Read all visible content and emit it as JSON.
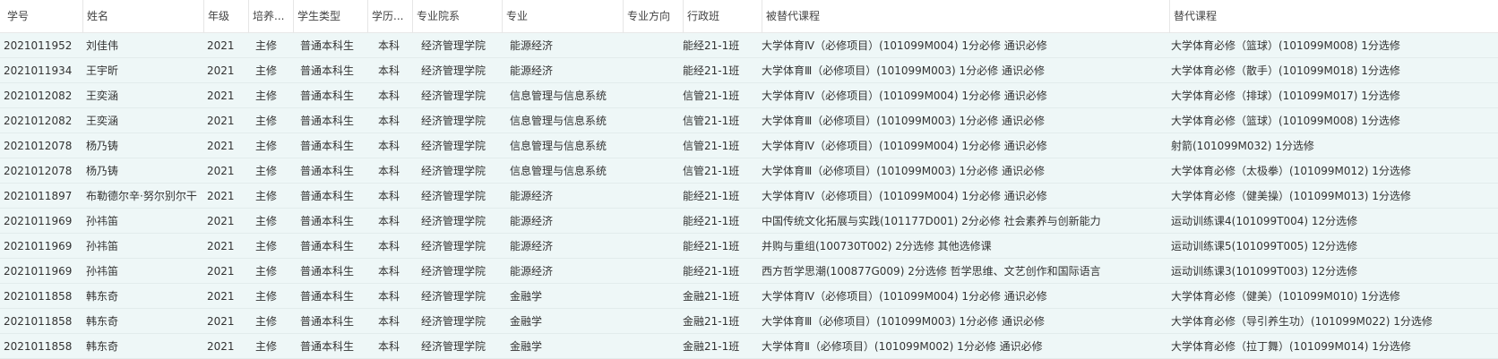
{
  "table": {
    "headers": [
      "学号",
      "姓名",
      "年级",
      "培养...",
      "学生类型",
      "学历...",
      "专业院系",
      "专业",
      "专业方向",
      "行政班",
      "被替代课程",
      "替代课程"
    ],
    "rows": [
      [
        "2021011952",
        "刘佳伟",
        "2021",
        "主修",
        "普通本科生",
        "本科",
        "经济管理学院",
        "能源经济",
        "",
        "能经21-1班",
        "大学体育Ⅳ（必修项目）(101099M004) 1分必修 通识必修",
        "大学体育必修（篮球）(101099M008) 1分选修"
      ],
      [
        "2021011934",
        "王宇昕",
        "2021",
        "主修",
        "普通本科生",
        "本科",
        "经济管理学院",
        "能源经济",
        "",
        "能经21-1班",
        "大学体育Ⅲ（必修项目）(101099M003) 1分必修 通识必修",
        "大学体育必修（散手）(101099M018) 1分选修"
      ],
      [
        "2021012082",
        "王奕涵",
        "2021",
        "主修",
        "普通本科生",
        "本科",
        "经济管理学院",
        "信息管理与信息系统",
        "",
        "信管21-1班",
        "大学体育Ⅳ（必修项目）(101099M004) 1分必修 通识必修",
        "大学体育必修（排球）(101099M017) 1分选修"
      ],
      [
        "2021012082",
        "王奕涵",
        "2021",
        "主修",
        "普通本科生",
        "本科",
        "经济管理学院",
        "信息管理与信息系统",
        "",
        "信管21-1班",
        "大学体育Ⅲ（必修项目）(101099M003) 1分必修 通识必修",
        "大学体育必修（篮球）(101099M008) 1分选修"
      ],
      [
        "2021012078",
        "杨乃铸",
        "2021",
        "主修",
        "普通本科生",
        "本科",
        "经济管理学院",
        "信息管理与信息系统",
        "",
        "信管21-1班",
        "大学体育Ⅳ（必修项目）(101099M004) 1分必修 通识必修",
        "射箭(101099M032) 1分选修"
      ],
      [
        "2021012078",
        "杨乃铸",
        "2021",
        "主修",
        "普通本科生",
        "本科",
        "经济管理学院",
        "信息管理与信息系统",
        "",
        "信管21-1班",
        "大学体育Ⅲ（必修项目）(101099M003) 1分必修 通识必修",
        "大学体育必修（太极拳）(101099M012) 1分选修"
      ],
      [
        "2021011897",
        "布勒德尔辛·努尔别尔干",
        "2021",
        "主修",
        "普通本科生",
        "本科",
        "经济管理学院",
        "能源经济",
        "",
        "能经21-1班",
        "大学体育Ⅳ（必修项目）(101099M004) 1分必修 通识必修",
        "大学体育必修（健美操）(101099M013) 1分选修"
      ],
      [
        "2021011969",
        "孙祎笛",
        "2021",
        "主修",
        "普通本科生",
        "本科",
        "经济管理学院",
        "能源经济",
        "",
        "能经21-1班",
        "中国传统文化拓展与实践(101177D001) 2分必修 社会素养与创新能力",
        "运动训练课4(101099T004) 12分选修"
      ],
      [
        "2021011969",
        "孙祎笛",
        "2021",
        "主修",
        "普通本科生",
        "本科",
        "经济管理学院",
        "能源经济",
        "",
        "能经21-1班",
        "并购与重组(100730T002) 2分选修 其他选修课",
        "运动训练课5(101099T005) 12分选修"
      ],
      [
        "2021011969",
        "孙祎笛",
        "2021",
        "主修",
        "普通本科生",
        "本科",
        "经济管理学院",
        "能源经济",
        "",
        "能经21-1班",
        "西方哲学思潮(100877G009) 2分选修 哲学思维、文艺创作和国际语言",
        "运动训练课3(101099T003) 12分选修"
      ],
      [
        "2021011858",
        "韩东奇",
        "2021",
        "主修",
        "普通本科生",
        "本科",
        "经济管理学院",
        "金融学",
        "",
        "金融21-1班",
        "大学体育Ⅳ（必修项目）(101099M004) 1分必修 通识必修",
        "大学体育必修（健美）(101099M010) 1分选修"
      ],
      [
        "2021011858",
        "韩东奇",
        "2021",
        "主修",
        "普通本科生",
        "本科",
        "经济管理学院",
        "金融学",
        "",
        "金融21-1班",
        "大学体育Ⅲ（必修项目）(101099M003) 1分必修 通识必修",
        "大学体育必修（导引养生功）(101099M022) 1分选修"
      ],
      [
        "2021011858",
        "韩东奇",
        "2021",
        "主修",
        "普通本科生",
        "本科",
        "经济管理学院",
        "金融学",
        "",
        "金融21-1班",
        "大学体育Ⅱ（必修项目）(101099M002) 1分必修 通识必修",
        "大学体育必修（拉丁舞）(101099M014) 1分选修"
      ]
    ]
  }
}
